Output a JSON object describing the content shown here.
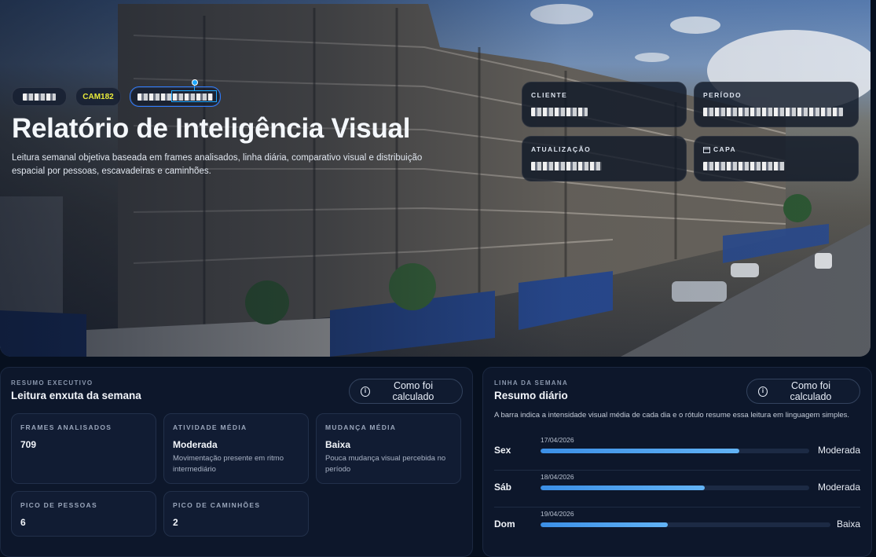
{
  "hero": {
    "chips": [
      {
        "type": "redacted"
      },
      {
        "label": "CAM182"
      },
      {
        "type": "redacted"
      }
    ],
    "title": "Relatório de Inteligência Visual",
    "description": "Leitura semanal objetiva baseada em frames analisados, linha diária, comparativo visual e distribuição espacial por pessoas, escavadeiras e caminhões.",
    "meta": [
      {
        "label": "CLIENTE"
      },
      {
        "label": "PERÍODO"
      },
      {
        "label": "ATUALIZAÇÃO"
      },
      {
        "label": "CAPA",
        "icon": "calendar-icon"
      }
    ]
  },
  "summary": {
    "eyebrow": "RESUMO EXECUTIVO",
    "title": "Leitura enxuta da semana",
    "button": "Como foi calculado",
    "stats": [
      {
        "label": "FRAMES ANALISADOS",
        "value": "709"
      },
      {
        "label": "ATIVIDADE MÉDIA",
        "value": "Moderada",
        "desc": "Movimentação presente em ritmo intermediário"
      },
      {
        "label": "MUDANÇA MÉDIA",
        "value": "Baixa",
        "desc": "Pouca mudança visual percebida no período"
      },
      {
        "label": "PICO DE PESSOAS",
        "value": "6"
      },
      {
        "label": "PICO DE CAMINHÕES",
        "value": "2"
      }
    ]
  },
  "weekline": {
    "eyebrow": "LINHA DA SEMANA",
    "title": "Resumo diário",
    "button": "Como foi calculado",
    "note": "A barra indica a intensidade visual média de cada dia e o rótulo resume essa leitura em linguagem simples.",
    "days": [
      {
        "day": "Sex",
        "date": "17/04/2026",
        "level": "Moderada",
        "intensity": 0.74
      },
      {
        "day": "Sáb",
        "date": "18/04/2026",
        "level": "Moderada",
        "intensity": 0.61
      },
      {
        "day": "Dom",
        "date": "19/04/2026",
        "level": "Baixa",
        "intensity": 0.44
      }
    ]
  },
  "colors": {
    "accent": "#4ea3ef",
    "cam_chip": "#e8ea3b",
    "selection": "#1ea7ff"
  }
}
